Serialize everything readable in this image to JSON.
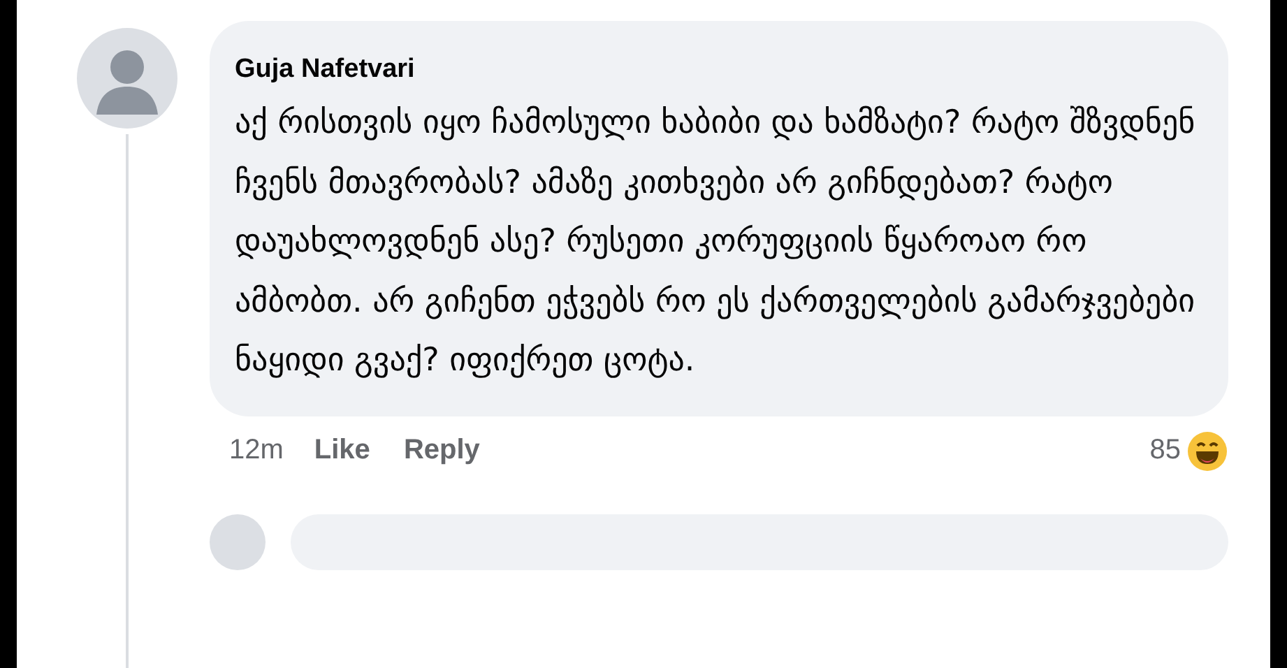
{
  "comment": {
    "author": "Guja Nafetvari",
    "text": "აქ რისთვის იყო ჩამოსული ხაბიბი და ხამზატი? რატო შზვდნენ ჩვენს მთავრობას? ამაზე კითხვები არ გიჩნდებათ? რატო დაუახლოვდნენ ასე? რუსეთი კორუფციის წყაროაო რო ამბობთ. არ გიჩენთ ეჭვებს რო ეს ქართველების გამარჯვებები ნაყიდი გვაქ? იფიქრეთ ცოტა.",
    "time": "12m",
    "actions": [
      "Like",
      "Reply"
    ],
    "reaction_count": "85"
  }
}
